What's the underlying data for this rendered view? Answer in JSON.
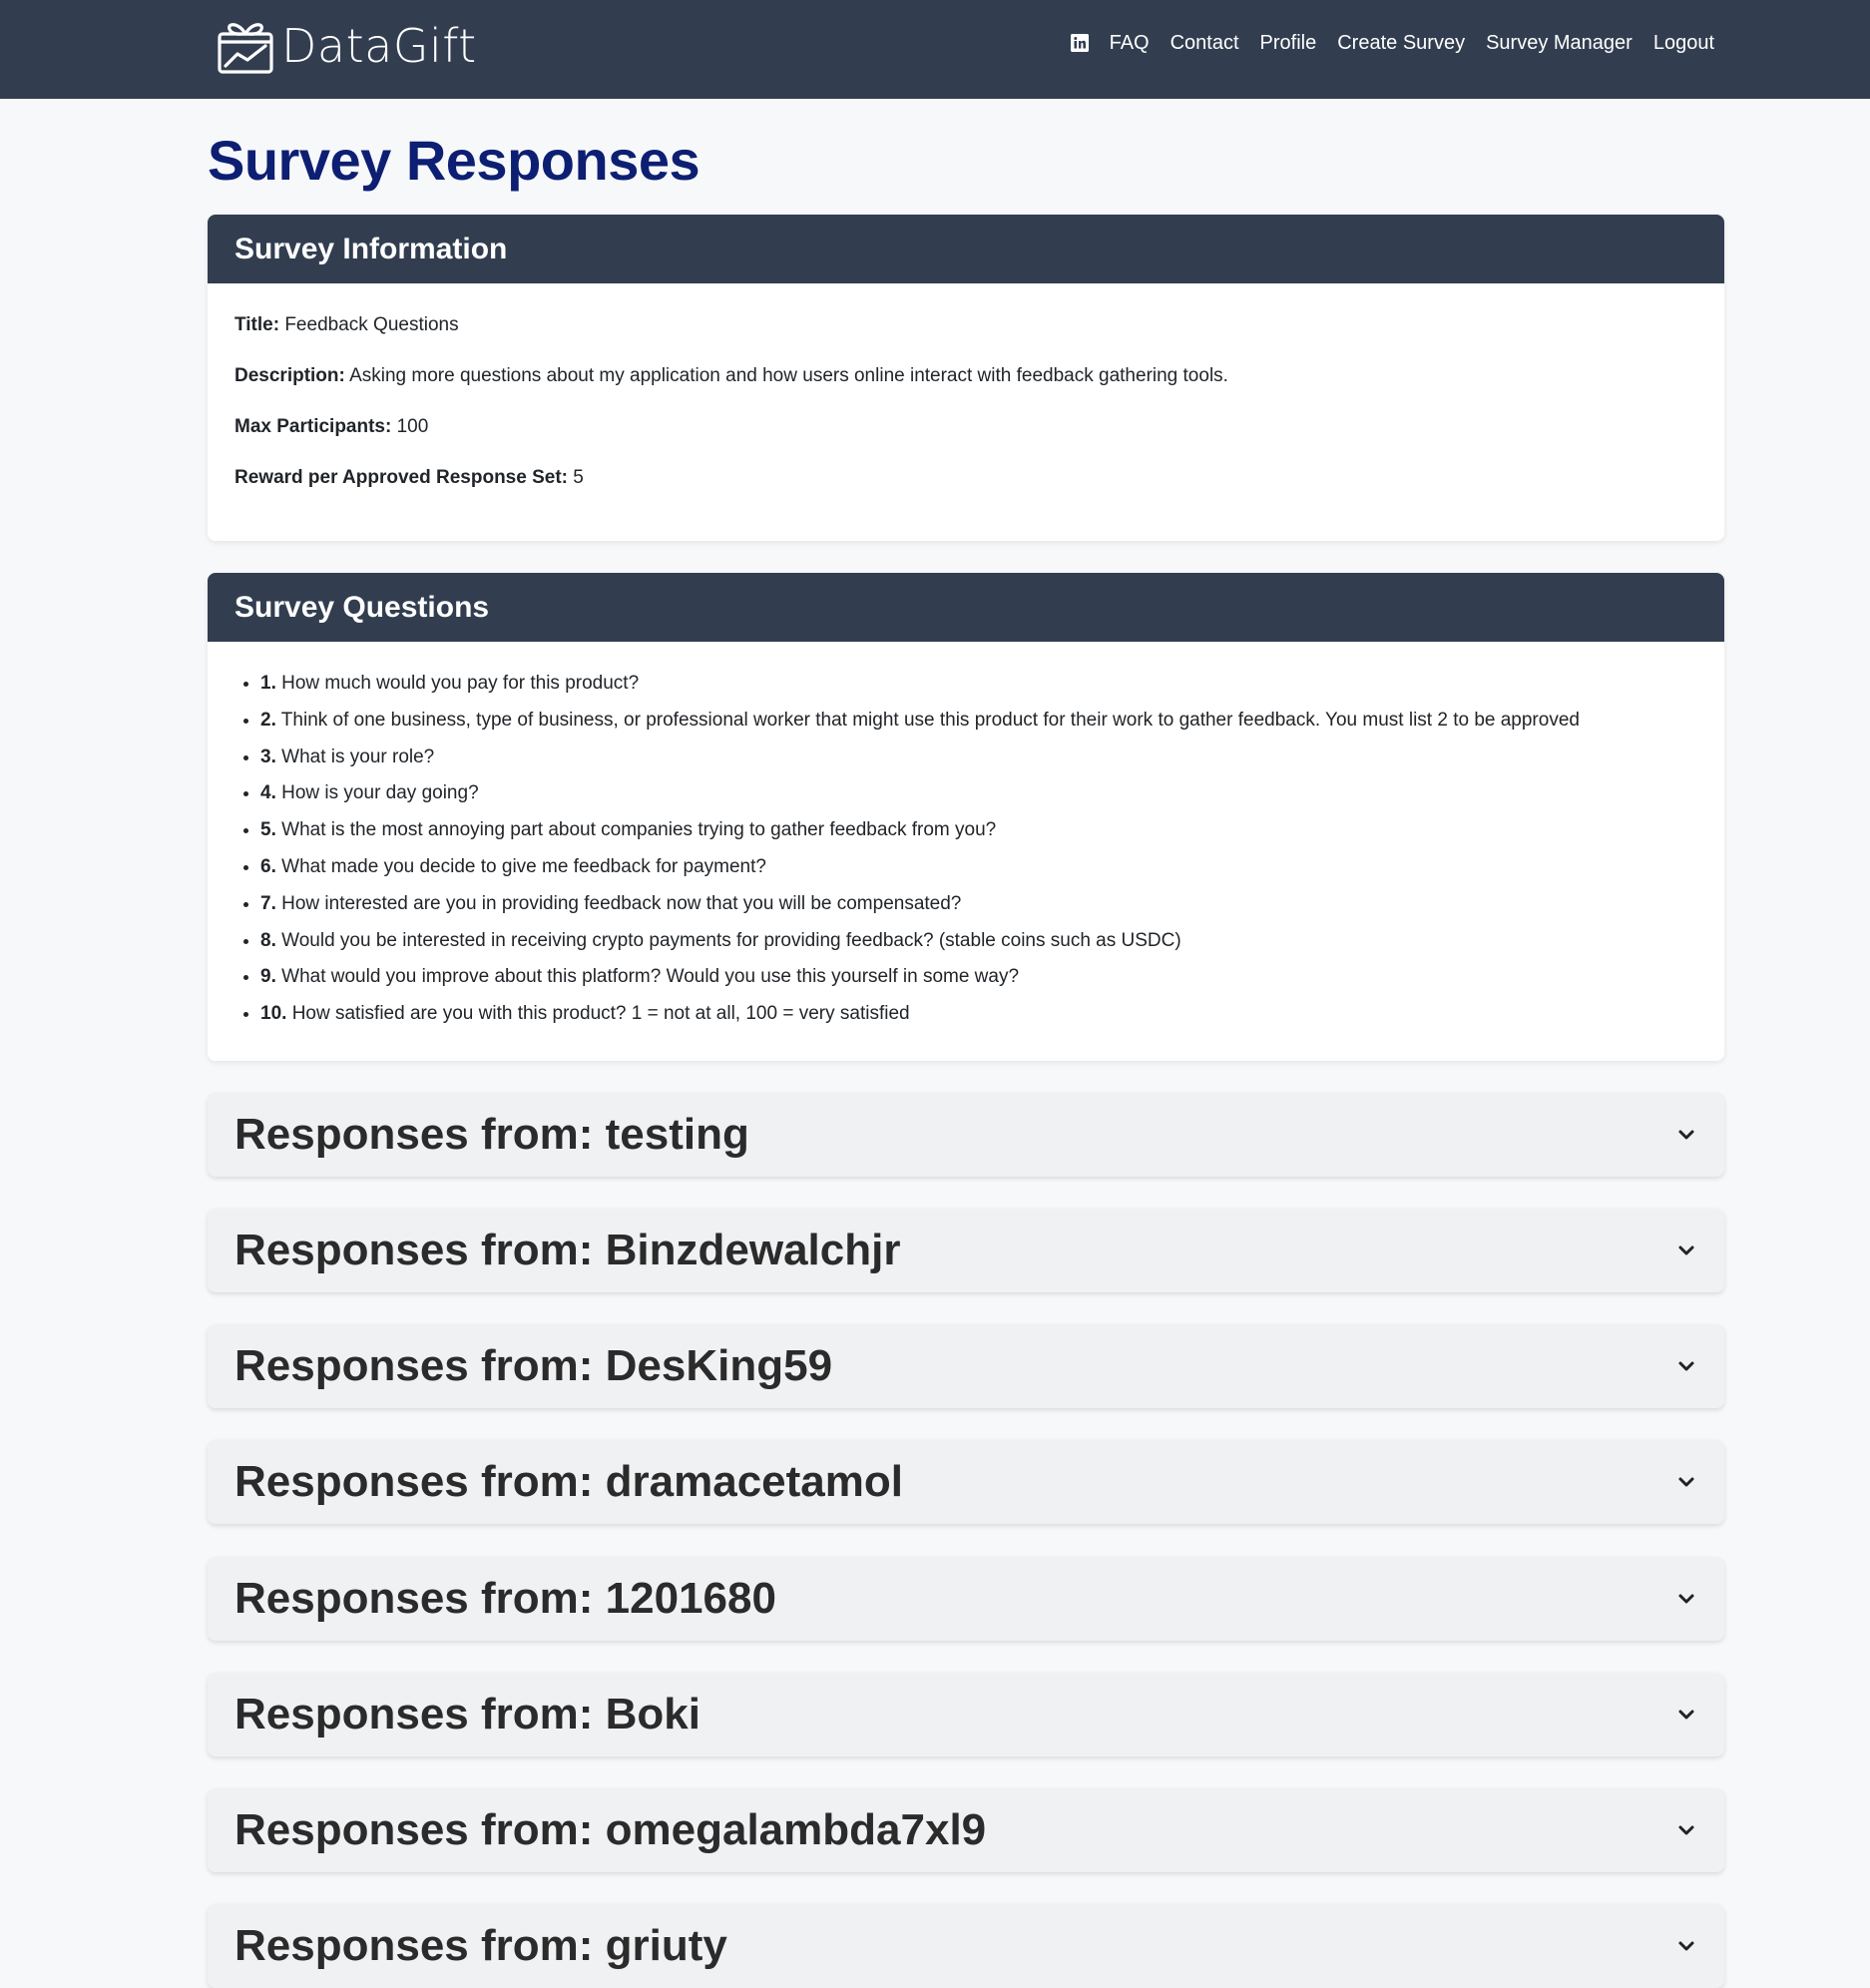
{
  "brand": {
    "name": "DataGift",
    "icon": "gift-chart-icon"
  },
  "nav": {
    "linkedin_icon": "linkedin-icon",
    "links": [
      "FAQ",
      "Contact",
      "Profile",
      "Create Survey",
      "Survey Manager",
      "Logout"
    ]
  },
  "page_title": "Survey Responses",
  "survey_info": {
    "header": "Survey Information",
    "title_label": "Title:",
    "title_value": "Feedback Questions",
    "description_label": "Description:",
    "description_value": "Asking more questions about my application and how users online interact with feedback gathering tools.",
    "max_label": "Max Participants:",
    "max_value": "100",
    "reward_label": "Reward per Approved Response Set:",
    "reward_value": "5"
  },
  "survey_questions": {
    "header": "Survey Questions",
    "items": [
      {
        "num": "1.",
        "text": "How much would you pay for this product?"
      },
      {
        "num": "2.",
        "text": "Think of one business, type of business, or professional worker that might use this product for their work to gather feedback. You must list 2 to be approved"
      },
      {
        "num": "3.",
        "text": "What is your role?"
      },
      {
        "num": "4.",
        "text": "How is your day going?"
      },
      {
        "num": "5.",
        "text": "What is the most annoying part about companies trying to gather feedback from you?"
      },
      {
        "num": "6.",
        "text": "What made you decide to give me feedback for payment?"
      },
      {
        "num": "7.",
        "text": "How interested are you in providing feedback now that you will be compensated?"
      },
      {
        "num": "8.",
        "text": "Would you be interested in receiving crypto payments for providing feedback? (stable coins such as USDC)"
      },
      {
        "num": "9.",
        "text": "What would you improve about this platform? Would you use this yourself in some way?"
      },
      {
        "num": "10.",
        "text": "How satisfied are you with this product? 1 = not at all, 100 = very satisfied"
      }
    ]
  },
  "responses": [
    "Responses from: testing",
    "Responses from: Binzdewalchjr",
    "Responses from: DesKing59",
    "Responses from: dramacetamol",
    "Responses from: 1201680",
    "Responses from: Boki",
    "Responses from: omegalambda7xl9",
    "Responses from: griuty"
  ],
  "colors": {
    "navbar": "#323e50",
    "title": "#0d1f72",
    "page_bg": "#f7f8fa",
    "accordion_bg": "#f0f1f3"
  }
}
